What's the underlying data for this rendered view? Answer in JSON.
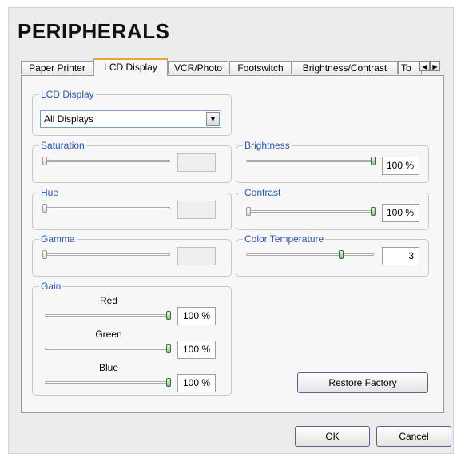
{
  "title": "PERIPHERALS",
  "tabs": [
    {
      "label": "Paper Printer"
    },
    {
      "label": "LCD Display"
    },
    {
      "label": "VCR/Photo"
    },
    {
      "label": "Footswitch"
    },
    {
      "label": "Brightness/Contrast"
    },
    {
      "label": "To"
    }
  ],
  "tab_nav": {
    "left": "◀",
    "right": "▶"
  },
  "lcd_display": {
    "legend": "LCD Display",
    "selected": "All Displays",
    "arrow": "▼"
  },
  "saturation": {
    "legend": "Saturation",
    "value": "",
    "level": 0
  },
  "hue": {
    "legend": "Hue",
    "value": "",
    "level": 0
  },
  "gamma": {
    "legend": "Gamma",
    "value": "",
    "level": 0
  },
  "brightness": {
    "legend": "Brightness",
    "value": "100 %",
    "level": 1.0
  },
  "contrast": {
    "legend": "Contrast",
    "value": "100 %",
    "level": 1.0
  },
  "color_temperature": {
    "legend": "Color Temperature",
    "value": "3",
    "level": 0.75
  },
  "gain": {
    "legend": "Gain",
    "red": {
      "label": "Red",
      "value": "100 %",
      "level": 1.0
    },
    "green": {
      "label": "Green",
      "value": "100 %",
      "level": 1.0
    },
    "blue": {
      "label": "Blue",
      "value": "100 %",
      "level": 1.0
    }
  },
  "restore_label": "Restore Factory",
  "ok_label": "OK",
  "cancel_label": "Cancel",
  "colors": {
    "accent_tab": "#e8a53b",
    "legend_text": "#2a55b8",
    "slider_thumb": "#7ec27e"
  }
}
